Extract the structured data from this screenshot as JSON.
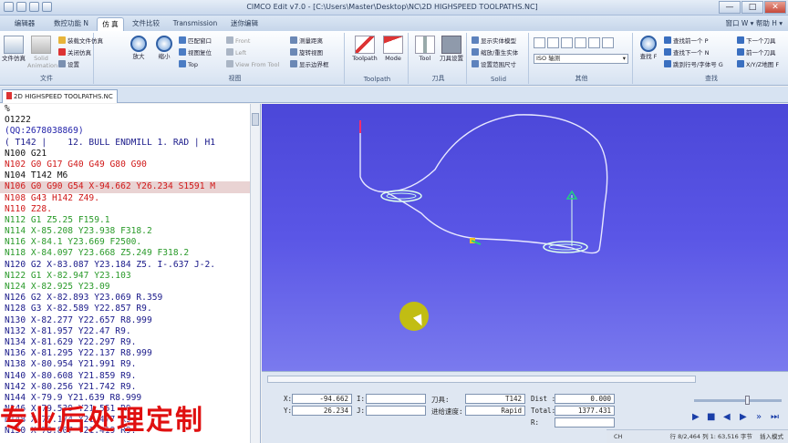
{
  "window": {
    "title": "CIMCO Edit v7.0 - [C:\\Users\\Master\\Desktop\\NC\\2D HIGHSPEED TOOLPATHS.NC]",
    "buttons": [
      "—",
      "□",
      "✕"
    ]
  },
  "tabs": [
    "编辑器",
    "数控功能 N",
    "仿 真",
    "文件比较",
    "Transmission",
    "迷你编辑"
  ],
  "tab_right": "窗口 W  ▾   帮助 H  ▾",
  "ribbon": {
    "file": {
      "label": "文件",
      "big": [
        "文件仿真",
        "Solid Animation"
      ],
      "small": [
        "装载文件仿真",
        "关闭仿真",
        "设置"
      ]
    },
    "view": {
      "label": "视图",
      "big": [
        "放大",
        "缩小"
      ],
      "small": [
        "匹配窗口",
        "视图复位",
        "Top",
        "Front",
        "Left",
        "View From Tool",
        "测量距离",
        "旋转视图",
        "显示边界框"
      ]
    },
    "toolpath": {
      "label": "Toolpath",
      "big": [
        "Toolpath",
        "Mode"
      ]
    },
    "tools": {
      "label": "刀具",
      "big": [
        "Tool",
        "刀具设置"
      ]
    },
    "solid": {
      "label": "Solid",
      "small": [
        "显示实体模型",
        "缩放/重生实体",
        "设置范围尺寸"
      ]
    },
    "other": {
      "label": "其他",
      "combo": "ISO 轴测"
    },
    "find": {
      "label": "查找",
      "big": [
        "查找 F"
      ],
      "small": [
        "查找前一个 P",
        "查找下一个 N",
        "跳到行号/字体号 G",
        "下一个刀具",
        "前一个刀具",
        "X/Y/Z地图 F"
      ]
    }
  },
  "doc_tab": "2D HIGHSPEED TOOLPATHS.NC",
  "code_lines": [
    {
      "t": "%",
      "c": "c-blk"
    },
    {
      "t": "O1222",
      "c": "c-blk"
    },
    {
      "t": "(QQ:2678038869)",
      "c": "c-blu"
    },
    {
      "t": "( T142 |    12. BULL ENDMILL 1. RAD | H1",
      "c": "c-nav"
    },
    {
      "t": "N100 G21",
      "c": "c-blk"
    },
    {
      "t": "N102 G0 G17 G40 G49 G80 G90",
      "c": "c-red"
    },
    {
      "t": "N104 T142 M6",
      "c": "c-blk"
    },
    {
      "t": "N106 G0 G90 G54 X-94.662 Y26.234 S1591 M",
      "c": "c-red",
      "sel": true
    },
    {
      "t": "N108 G43 H142 Z49.",
      "c": "c-red"
    },
    {
      "t": "N110 Z28.",
      "c": "c-red"
    },
    {
      "t": "N112 G1 Z5.25 F159.1",
      "c": "c-grn"
    },
    {
      "t": "N114 X-85.208 Y23.938 F318.2",
      "c": "c-grn"
    },
    {
      "t": "N116 X-84.1 Y23.669 F2500.",
      "c": "c-grn"
    },
    {
      "t": "N118 X-84.097 Y23.668 Z5.249 F318.2",
      "c": "c-grn"
    },
    {
      "t": "N120 G2 X-83.087 Y23.184 Z5. I-.637 J-2.",
      "c": "c-nav"
    },
    {
      "t": "N122 G1 X-82.947 Y23.103",
      "c": "c-grn"
    },
    {
      "t": "N124 X-82.925 Y23.09",
      "c": "c-grn"
    },
    {
      "t": "N126 G2 X-82.893 Y23.069 R.359",
      "c": "c-nav"
    },
    {
      "t": "N128 G3 X-82.589 Y22.857 R9.",
      "c": "c-nav"
    },
    {
      "t": "N130 X-82.277 Y22.657 R8.999",
      "c": "c-nav"
    },
    {
      "t": "N132 X-81.957 Y22.47 R9.",
      "c": "c-nav"
    },
    {
      "t": "N134 X-81.629 Y22.297 R9.",
      "c": "c-nav"
    },
    {
      "t": "N136 X-81.295 Y22.137 R8.999",
      "c": "c-nav"
    },
    {
      "t": "N138 X-80.954 Y21.991 R9.",
      "c": "c-nav"
    },
    {
      "t": "N140 X-80.608 Y21.859 R9.",
      "c": "c-nav"
    },
    {
      "t": "N142 X-80.256 Y21.742 R9.",
      "c": "c-nav"
    },
    {
      "t": "N144 X-79.9 Y21.639 R8.999",
      "c": "c-nav"
    },
    {
      "t": "N146 X-79.539 Y21.551 R9.",
      "c": "c-nav"
    },
    {
      "t": "N148 X-79.174 Y21.477 R9.",
      "c": "c-nav"
    },
    {
      "t": "N150 X-78.807 Y21.419 R9.",
      "c": "c-nav"
    }
  ],
  "overlay_text": "专业后处理定制",
  "sim": {
    "x_label": "X:",
    "x_value": "-94.662",
    "y_label": "Y:",
    "y_value": "26.234",
    "i_label": "I:",
    "j_label": "J:",
    "tool_label": "刀具:",
    "tool_value": "T142",
    "feed_label": "进给速度:",
    "feed_value": "Rapid",
    "dist_label": "Dist :",
    "dist_value": "0.000",
    "total_label": "Total:",
    "total_value": "1377.431",
    "r_label": "R:"
  },
  "status": {
    "lang": "CH",
    "line": "行 8/2,464 列 1: 63,516 字节",
    "mode": "插入模式"
  }
}
